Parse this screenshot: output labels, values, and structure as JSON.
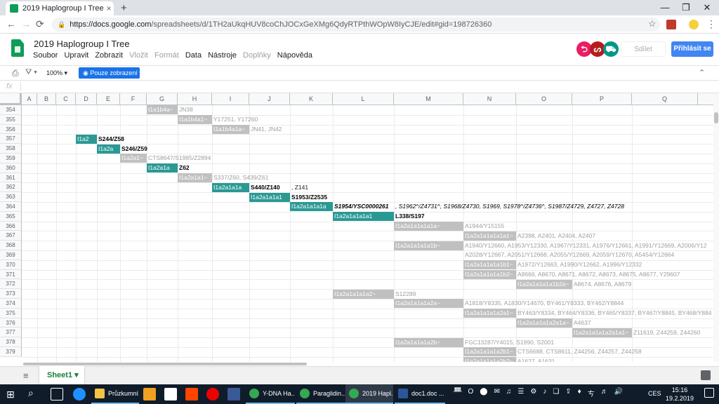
{
  "browser": {
    "tab_title": "2019 Haplogroup I Tree - Tabulky",
    "tab_close": "×",
    "new_tab": "+",
    "minimize": "—",
    "maximize": "❐",
    "close": "✕",
    "url_host": "https://docs.google.com",
    "url_path": "/spreadsheets/d/1TH2aUkqHUV8coChJOCxGeXMg6QdyRTPthWOpW8IyCJE/edit#gid=198726360"
  },
  "doc": {
    "title": "2019 Haplogroup I Tree",
    "menu": [
      {
        "label": "Soubor",
        "disabled": false
      },
      {
        "label": "Upravit",
        "disabled": false
      },
      {
        "label": "Zobrazit",
        "disabled": false
      },
      {
        "label": "Vložit",
        "disabled": true
      },
      {
        "label": "Formát",
        "disabled": true
      },
      {
        "label": "Data",
        "disabled": false
      },
      {
        "label": "Nástroje",
        "disabled": false
      },
      {
        "label": "Doplňky",
        "disabled": true
      },
      {
        "label": "Nápověda",
        "disabled": false
      }
    ],
    "share_label": "Sdílet",
    "signin_label": "Přihlásit se",
    "avatars": [
      {
        "color": "#e91e63",
        "glyph": "⮌"
      },
      {
        "color": "#b71c1c",
        "glyph": "ᔕ"
      },
      {
        "color": "#009688",
        "glyph": "⛟"
      }
    ]
  },
  "toolbar": {
    "zoom": "100%",
    "view_mode": "Pouze zobrazení",
    "fx": "fx"
  },
  "columns": [
    {
      "label": "A"
    },
    {
      "label": "B"
    },
    {
      "label": "C"
    },
    {
      "label": "D"
    },
    {
      "label": "E"
    },
    {
      "label": "F"
    },
    {
      "label": "G"
    },
    {
      "label": "H"
    },
    {
      "label": "I"
    },
    {
      "label": "J"
    },
    {
      "label": "K"
    },
    {
      "label": "L"
    },
    {
      "label": "M"
    },
    {
      "label": "N"
    },
    {
      "label": "O"
    },
    {
      "label": "P"
    },
    {
      "label": "Q"
    }
  ],
  "rows": [
    "354",
    "355",
    "356",
    "357",
    "358",
    "359",
    "360",
    "361",
    "362",
    "363",
    "364",
    "365",
    "366",
    "367",
    "368",
    "369",
    "370",
    "371",
    "372",
    "373",
    "374",
    "375",
    "376",
    "377",
    "378",
    "379"
  ],
  "cells": [
    {
      "row": 0,
      "col": 6,
      "text": "I1a1b4a~",
      "style": "grey"
    },
    {
      "row": 0,
      "col": 7,
      "text": "JN38",
      "style": "gt"
    },
    {
      "row": 1,
      "col": 7,
      "text": "I1a1b4a1~",
      "style": "grey"
    },
    {
      "row": 1,
      "col": 8,
      "text": "Y17251, Y17260",
      "style": "gt"
    },
    {
      "row": 2,
      "col": 8,
      "text": "I1a1b4a1a~",
      "style": "grey"
    },
    {
      "row": 2,
      "col": 9,
      "text": "JN41, JN42",
      "style": "gt"
    },
    {
      "row": 3,
      "col": 3,
      "text": "I1a2",
      "style": "teal"
    },
    {
      "row": 3,
      "col": 4,
      "text": "S244/Z58",
      "style": "bt"
    },
    {
      "row": 4,
      "col": 4,
      "text": "I1a2a",
      "style": "teal"
    },
    {
      "row": 4,
      "col": 5,
      "text": "S246/Z59",
      "style": "bt"
    },
    {
      "row": 5,
      "col": 5,
      "text": "I1a2a1~",
      "style": "grey"
    },
    {
      "row": 5,
      "col": 6,
      "text": "CTS8647/S1985/Z2894",
      "style": "gt"
    },
    {
      "row": 6,
      "col": 6,
      "text": "I1a2a1a",
      "style": "teal"
    },
    {
      "row": 6,
      "col": 7,
      "text": "Z62",
      "style": "bt"
    },
    {
      "row": 7,
      "col": 7,
      "text": "I1a2a1a1~",
      "style": "grey"
    },
    {
      "row": 7,
      "col": 8,
      "text": "S337/Z60, S439/Z61",
      "style": "gt"
    },
    {
      "row": 8,
      "col": 8,
      "text": "I1a2a1a1a",
      "style": "teal"
    },
    {
      "row": 8,
      "col": 9,
      "text": "S440/Z140",
      "style": "bt"
    },
    {
      "row": 8,
      "col": 10,
      "text": ", Z141",
      "style": "plain"
    },
    {
      "row": 9,
      "col": 9,
      "text": "I1a2a1a1a1",
      "style": "teal"
    },
    {
      "row": 9,
      "col": 10,
      "text": "S1953/Z2535",
      "style": "bt"
    },
    {
      "row": 10,
      "col": 10,
      "text": "I1a2a1a1a1a",
      "style": "teal"
    },
    {
      "row": 10,
      "col": 11,
      "text": "S1954/YSC0000261",
      "style": "bi"
    },
    {
      "row": 10,
      "col": 12,
      "text": ", S1962^/Z4731^, S1968/Z4730, S1969, S1978^/Z4736^, S1987/Z4729, Z4727, Z4728",
      "style": "it"
    },
    {
      "row": 11,
      "col": 11,
      "text": "I1a2a1a1a1a1",
      "style": "teal"
    },
    {
      "row": 11,
      "col": 12,
      "text": "L338/S197",
      "style": "bt"
    },
    {
      "row": 12,
      "col": 12,
      "text": "I1a2a1a1a1a1a~",
      "style": "grey"
    },
    {
      "row": 12,
      "col": 13,
      "text": "A1944/Y15155",
      "style": "gt"
    },
    {
      "row": 13,
      "col": 13,
      "text": "I1a2a1a1a1a1a1~",
      "style": "grey"
    },
    {
      "row": 13,
      "col": 14,
      "text": "A2398, A2401, A2404, A2407",
      "style": "gt"
    },
    {
      "row": 14,
      "col": 12,
      "text": "I1a2a1a1a1a1b~",
      "style": "grey"
    },
    {
      "row": 14,
      "col": 13,
      "text": "A1940/Y12660, A1953/Y12330, A1967/Y12331, A1976/Y12661, A1991/Y12669, A2006/Y12",
      "style": "gt"
    },
    {
      "row": 15,
      "col": 13,
      "text": "A2028/Y12667, A2051/Y12668, A2055/Y12669, A2059/Y12670, A5454/Y12664",
      "style": "gt"
    },
    {
      "row": 16,
      "col": 13,
      "text": "I1a2a1a1a1a1b1~",
      "style": "grey"
    },
    {
      "row": 16,
      "col": 14,
      "text": "A1972/Y12663, A1990/Y12662, A1996/Y12332",
      "style": "gt"
    },
    {
      "row": 17,
      "col": 13,
      "text": "I1a2a1a1a1a1b2~",
      "style": "grey"
    },
    {
      "row": 17,
      "col": 14,
      "text": "A8666, A8670, A8671, A8672, A8673, A8675, A8677, Y29607",
      "style": "gt"
    },
    {
      "row": 18,
      "col": 14,
      "text": "I1a2a1a1a1a1b2a~",
      "style": "grey"
    },
    {
      "row": 18,
      "col": 15,
      "text": "A8674, A8676, A8679",
      "style": "gt"
    },
    {
      "row": 19,
      "col": 11,
      "text": "I1a2a1a1a1a2~",
      "style": "grey"
    },
    {
      "row": 19,
      "col": 12,
      "text": "S12289",
      "style": "gt"
    },
    {
      "row": 20,
      "col": 12,
      "text": "I1a2a1a1a1a2a~",
      "style": "grey"
    },
    {
      "row": 20,
      "col": 13,
      "text": "A1818/Y8335, A1830/Y14670, BY461/Y8333, BY462/Y8844",
      "style": "gt"
    },
    {
      "row": 21,
      "col": 13,
      "text": "I1a2a1a1a1a2a1~",
      "style": "grey"
    },
    {
      "row": 21,
      "col": 14,
      "text": "BY463/Y8334, BY464/Y8336, BY465/Y8337, BY467/Y8845, BY468/Y884",
      "style": "gt"
    },
    {
      "row": 22,
      "col": 14,
      "text": "I1a2a1a1a1a2a1a~",
      "style": "grey"
    },
    {
      "row": 22,
      "col": 15,
      "text": "A4637",
      "style": "gt"
    },
    {
      "row": 23,
      "col": 15,
      "text": "I1a2a1a1a1a2a1a1~",
      "style": "grey"
    },
    {
      "row": 23,
      "col": 16,
      "text": "Z11619, Z44259, Z44260",
      "style": "gt"
    },
    {
      "row": 24,
      "col": 12,
      "text": "I1a2a1a1a1a2b~",
      "style": "grey"
    },
    {
      "row": 24,
      "col": 13,
      "text": "FGC13287/Y4015, S1990, S2001",
      "style": "gt"
    },
    {
      "row": 25,
      "col": 13,
      "text": "I1a2a1a1a1a2b1~",
      "style": "grey"
    },
    {
      "row": 25,
      "col": 14,
      "text": "CTS6688, CTS8611, Z44256, Z44257, Z44258",
      "style": "gt"
    },
    {
      "row": 26,
      "col": 13,
      "text": "I1a2a1a1a1a2b2~",
      "style": "grey"
    },
    {
      "row": 26,
      "col": 14,
      "text": "A1627, A1631",
      "style": "gt"
    }
  ],
  "sheets": {
    "add": "+",
    "active": "Sheet1",
    "arrow": "▾"
  },
  "taskbar": {
    "start": "⊞",
    "search": "⌕",
    "apps": [
      {
        "label": "Průzkumní...",
        "color": "#f6c343"
      },
      {
        "label": "Y-DNA Ha...",
        "color": "#34a853"
      },
      {
        "label": "Paraglidin...",
        "color": "#34a853"
      },
      {
        "label": "2019 Hapl...",
        "color": "#34a853"
      },
      {
        "label": "doc1.doc ...",
        "color": "#2b579a"
      }
    ],
    "tray": [
      "ᚙ",
      "O",
      "⬤",
      "✉",
      "♫",
      "☰",
      "⚙",
      "♪",
      "❏",
      "⇪",
      "♦",
      "ㄘ",
      "♬",
      "🔊"
    ],
    "lang": "CES",
    "time": "15:16",
    "date": "19.2.2019"
  }
}
